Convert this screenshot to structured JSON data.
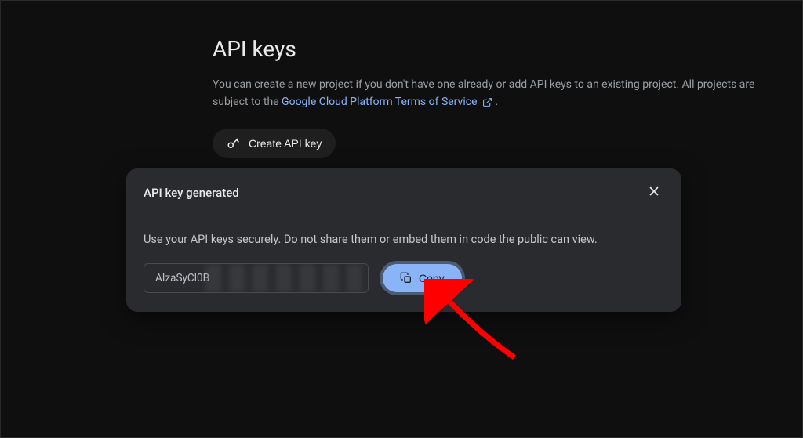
{
  "page": {
    "title": "API keys",
    "description_prefix": "You can create a new project if you don't have one already or add API keys to an existing project. All projects are subject to the ",
    "tos_link_text": "Google Cloud Platform Terms of Service",
    "description_suffix": ".",
    "create_button_label": "Create API key"
  },
  "modal": {
    "title": "API key generated",
    "message": "Use your API keys securely. Do not share them or embed them in code the public can view.",
    "key_visible_prefix": "AIzaSyCl0B",
    "copy_label": "Copy"
  },
  "colors": {
    "accent": "#8ab4f8",
    "bg": "#0f0f0f",
    "panel": "#2a2b2f"
  }
}
